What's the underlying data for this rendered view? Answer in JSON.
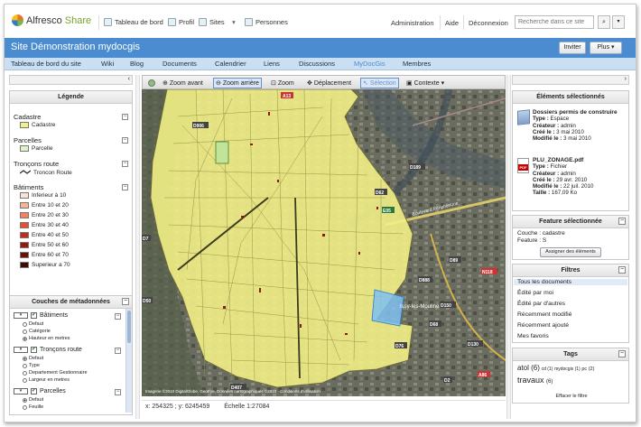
{
  "app": {
    "logo_a": "Alfresco",
    "logo_b": "Share"
  },
  "topnav": {
    "dashboard": "Tableau de bord",
    "profile": "Profil",
    "sites": "Sites",
    "people": "Personnes",
    "admin": "Administration",
    "help": "Aide",
    "logout": "Déconnexion",
    "search_placeholder": "Recherche dans ce site"
  },
  "site": {
    "title": "Site Démonstration mydocgis",
    "invite": "Inviter",
    "more": "Plus ▾"
  },
  "tabs": [
    "Tableau de bord du site",
    "Wiki",
    "Blog",
    "Documents",
    "Calendrier",
    "Liens",
    "Discussions",
    "MyDocGis",
    "Membres"
  ],
  "toolbar": {
    "zoom_in": "Zoom avant",
    "zoom_out": "Zoom arrière",
    "zoom": "Zoom",
    "pan": "Déplacement",
    "select": "Sélection",
    "context": "Contexte ▾"
  },
  "legend": {
    "title": "Légende",
    "groups": [
      {
        "title": "Cadastre",
        "items": [
          {
            "label": "Cadastre",
            "color": "#f1f08a"
          }
        ]
      },
      {
        "title": "Parcelles",
        "items": [
          {
            "label": "Parcelle",
            "color": "#dff2c8"
          }
        ]
      },
      {
        "title": "Tronçons route",
        "items": [
          {
            "label": "Troncon Route",
            "color": "line"
          }
        ]
      },
      {
        "title": "Bâtiments",
        "items": [
          {
            "label": "Inferieur à 10",
            "color": "#fbe1d6"
          },
          {
            "label": "Entre 10 et 20",
            "color": "#f8b394"
          },
          {
            "label": "Entre 20 et 30",
            "color": "#f4845d"
          },
          {
            "label": "Entre 30 et 40",
            "color": "#e8502d"
          },
          {
            "label": "Entre 40 et 50",
            "color": "#c32a17"
          },
          {
            "label": "Entre 50 et 60",
            "color": "#951a0e"
          },
          {
            "label": "Entre 60 et 70",
            "color": "#671207"
          },
          {
            "label": "Superieur a 70",
            "color": "#3f0a04"
          }
        ]
      }
    ]
  },
  "metadata": {
    "title": "Couches de métadonnées",
    "layers": [
      {
        "label": "Bâtiments",
        "options": [
          "Defaut",
          "Catégorie",
          "Hauteur en metres"
        ],
        "selected": 2
      },
      {
        "label": "Tronçons route",
        "options": [
          "Defaut",
          "Type",
          "Departement Gestionnaire",
          "Largeur en metres"
        ],
        "selected": 0
      },
      {
        "label": "Parcelles",
        "options": [
          "Defaut",
          "Feuille"
        ],
        "selected": 0
      }
    ]
  },
  "map": {
    "copyright": "Imagerie ©2010 DigitalGlobe, GeoEye, Données cartographiques ©2010 · Conditions d'utilisation",
    "roads": [
      "A13",
      "D7",
      "D906",
      "D50",
      "D888",
      "D89",
      "D76",
      "D68",
      "D130",
      "D2",
      "D407",
      "D62",
      "D189",
      "D150",
      "N118",
      "E05",
      "A86"
    ],
    "labels": [
      "Issy-les-Moulineaux",
      "Boulevard Périphérique"
    ]
  },
  "status": {
    "coords": "x: 254325 ; y: 6245459",
    "scale": "Échelle 1:27084"
  },
  "selected_elements": {
    "title": "Éléments sélectionnés",
    "docs": [
      {
        "name": "Dossiers permis de construire",
        "type_label": "Type :",
        "type": "Espace",
        "creator_label": "Créateur :",
        "creator": "admin",
        "created_label": "Créé le :",
        "created": "3 mai 2010",
        "modified_label": "Modifié le :",
        "modified": "3 mai 2010"
      },
      {
        "name": "PLU_ZONAGE.pdf",
        "type_label": "Type :",
        "type": "Fichier",
        "creator_label": "Créateur :",
        "creator": "admin",
        "created_label": "Créé le :",
        "created": "29 avr. 2010",
        "modified_label": "Modifié le :",
        "modified": "22 juil. 2010",
        "size_label": "Taille :",
        "size": "167,09 Ko"
      }
    ]
  },
  "feature": {
    "title": "Feature sélectionnée",
    "layer": "Couche : cadastre",
    "feature": "Feature : S",
    "assign": "Assigner des éléments"
  },
  "filters": {
    "title": "Filtres",
    "items": [
      "Tous les documents",
      "Édité par moi",
      "Édité par d'autres",
      "Récemment modifié",
      "Récemment ajouté",
      "Mes favoris"
    ],
    "active": 0
  },
  "tags": {
    "title": "Tags",
    "items": [
      {
        "name": "atol",
        "count": "(6)"
      },
      {
        "name": "cd",
        "count": "(1)"
      },
      {
        "name": "mydocgis",
        "count": "(1)"
      },
      {
        "name": "pc",
        "count": "(2)"
      },
      {
        "name": "travaux",
        "count": "(6)"
      }
    ],
    "clear": "Effacer le filtre"
  }
}
